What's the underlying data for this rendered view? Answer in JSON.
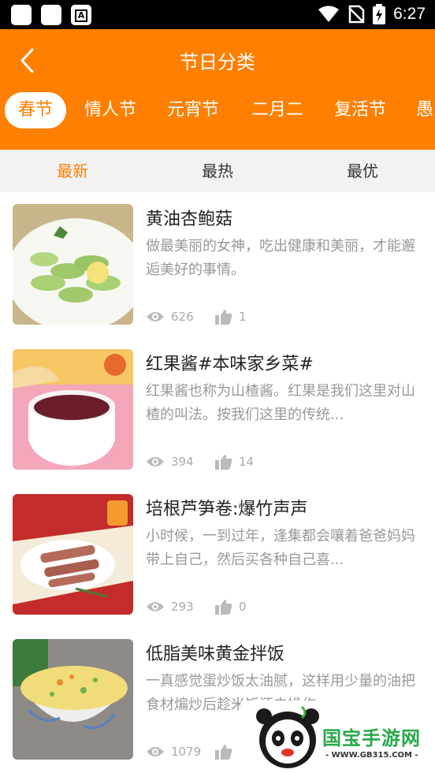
{
  "status_bar": {
    "time": "6:27"
  },
  "header": {
    "title": "节日分类",
    "back_icon": "chevron-left-icon"
  },
  "festival_tabs": [
    {
      "label": "春节",
      "active": true
    },
    {
      "label": "情人节",
      "active": false
    },
    {
      "label": "元宵节",
      "active": false
    },
    {
      "label": "二月二",
      "active": false
    },
    {
      "label": "复活节",
      "active": false
    },
    {
      "label": "愚",
      "active": false
    }
  ],
  "sort_tabs": [
    {
      "label": "最新",
      "active": true
    },
    {
      "label": "最热",
      "active": false
    },
    {
      "label": "最优",
      "active": false
    }
  ],
  "recipes": [
    {
      "title": "黄油杏鲍菇",
      "desc": "做最美丽的女神，吃出健康和美丽，才能邂逅美好的事情。",
      "views": "626",
      "likes": "1"
    },
    {
      "title": "红果酱#本味家乡菜#",
      "desc": "红果酱也称为山楂酱。红果是我们这里对山楂的叫法。按我们这里的传统...",
      "views": "394",
      "likes": "14"
    },
    {
      "title": "培根芦笋卷:爆竹声声",
      "desc": "小时候，一到过年，逢集都会嚷着爸爸妈妈带上自己，然后买各种自己喜...",
      "views": "293",
      "likes": "0"
    },
    {
      "title": "低脂美味黄金拌饭",
      "desc": "一真感觉蛋炒饭太油腻，这样用少量的油把食材煸炒后趁米饭还未操作",
      "views": "1079",
      "likes": ""
    }
  ],
  "watermark": {
    "brand": "国宝手游网",
    "url": "- WWW.GB315.COM -"
  },
  "colors": {
    "accent": "#ff7f00",
    "text_primary": "#222222",
    "text_secondary": "#999999"
  }
}
